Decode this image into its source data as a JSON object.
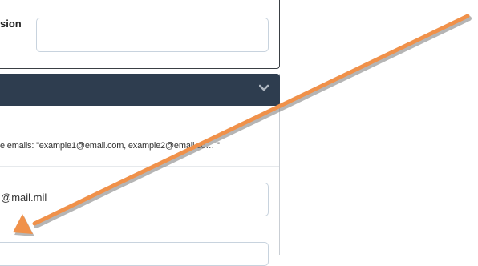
{
  "section": {
    "label_visible": "sion",
    "input_value": ""
  },
  "panel": {
    "icon": "chevron-down-icon",
    "hint_text": "e emails: \"example1@email.com, example2@email.co… \"",
    "email_value": "@mail.mil",
    "bottom_value": ""
  },
  "colors": {
    "header_bg": "#2e3d4f",
    "arrow": "#f0914a"
  }
}
